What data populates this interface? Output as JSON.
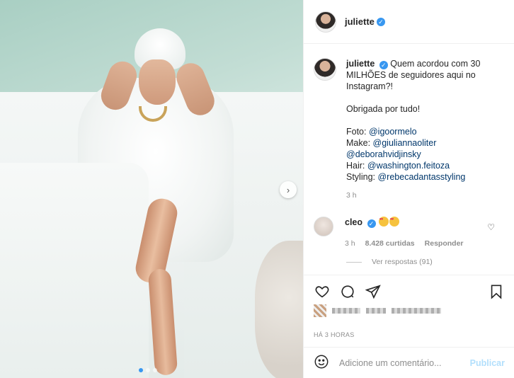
{
  "post": {
    "author": "juliette",
    "verified": true
  },
  "caption": {
    "username": "juliette",
    "lines": [
      "Quem acordou com 30",
      "MILHÕES de seguidores aqui no",
      "Instagram?!"
    ],
    "thanks": "Obrigada por tudo!",
    "credits": [
      {
        "label": "Foto:",
        "mention": "@igoormelo"
      },
      {
        "label": "Make:",
        "mention": "@giuliannaoliter"
      },
      {
        "label": "",
        "mention": "@deborahvidjinsky"
      },
      {
        "label": "Hair:",
        "mention": "@washington.feitoza"
      },
      {
        "label": "Styling:",
        "mention": "@rebecadantasstyling"
      }
    ],
    "time": "3 h"
  },
  "comment": {
    "username": "cleo",
    "emoji_count": 2,
    "time": "3 h",
    "likes": "8.428 curtidas",
    "reply_label": "Responder"
  },
  "replies_label": "Ver respostas (91)",
  "carousel": {
    "slides": 3,
    "active": 1
  },
  "timestamp": "HÁ 3 HORAS",
  "add_comment": {
    "placeholder": "Adicione um comentário...",
    "publish_label": "Publicar"
  },
  "icons": [
    "verified-icon",
    "next-arrow-icon",
    "heart-icon",
    "comment-icon",
    "share-icon",
    "bookmark-icon",
    "emoji-icon"
  ],
  "colors": {
    "link": "#00376b",
    "verified": "#3897f0",
    "publish_disabled": "#b2dffc",
    "meta": "#8e8e8e"
  }
}
